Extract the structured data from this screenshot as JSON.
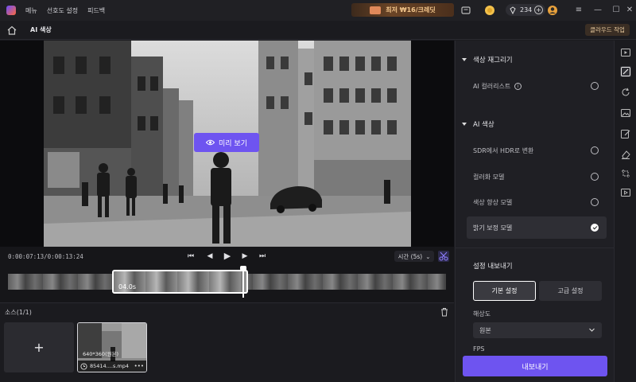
{
  "topbar": {
    "menus": [
      "메뉴",
      "선호도 설정",
      "피드백"
    ],
    "promo_label": "최저 ₩16/크레딧",
    "credits": "234"
  },
  "subbar": {
    "title": "AI 색상",
    "cloud_button": "클라우드 작업"
  },
  "preview": {
    "preview_button": "미리 보기"
  },
  "controls": {
    "timecode": "0:00:07:13/0:00:13:24",
    "speed": "시간 (5s)"
  },
  "timeline": {
    "clip_duration": "04.0s"
  },
  "sources": {
    "label": "소스(1/1)",
    "add_label": "+",
    "items": [
      {
        "resolution": "640*360(원본)",
        "name": "85414....s.mp4"
      }
    ]
  },
  "panel": {
    "recolor_section": "색상 재그리기",
    "recolor_options": [
      {
        "label": "AI 컬러리스트",
        "selected": false
      }
    ],
    "ai_color_section": "AI 색상",
    "ai_color_options": [
      {
        "label": "SDR에서 HDR로 변환",
        "selected": false
      },
      {
        "label": "컬러화 모델",
        "selected": false
      },
      {
        "label": "색상 향상 모델",
        "selected": false
      },
      {
        "label": "밝기 보정 모델",
        "selected": true
      }
    ],
    "export_section": "설정 내보내기",
    "tabs": [
      "기본 설정",
      "고급 설정"
    ],
    "resolution_label": "해상도",
    "resolution_value": "원본",
    "fps_label": "FPS",
    "export_button": "내보내기"
  },
  "colors": {
    "accent": "#6e54f0",
    "background": "#1b1b1f",
    "panel": "#1f1f24"
  }
}
